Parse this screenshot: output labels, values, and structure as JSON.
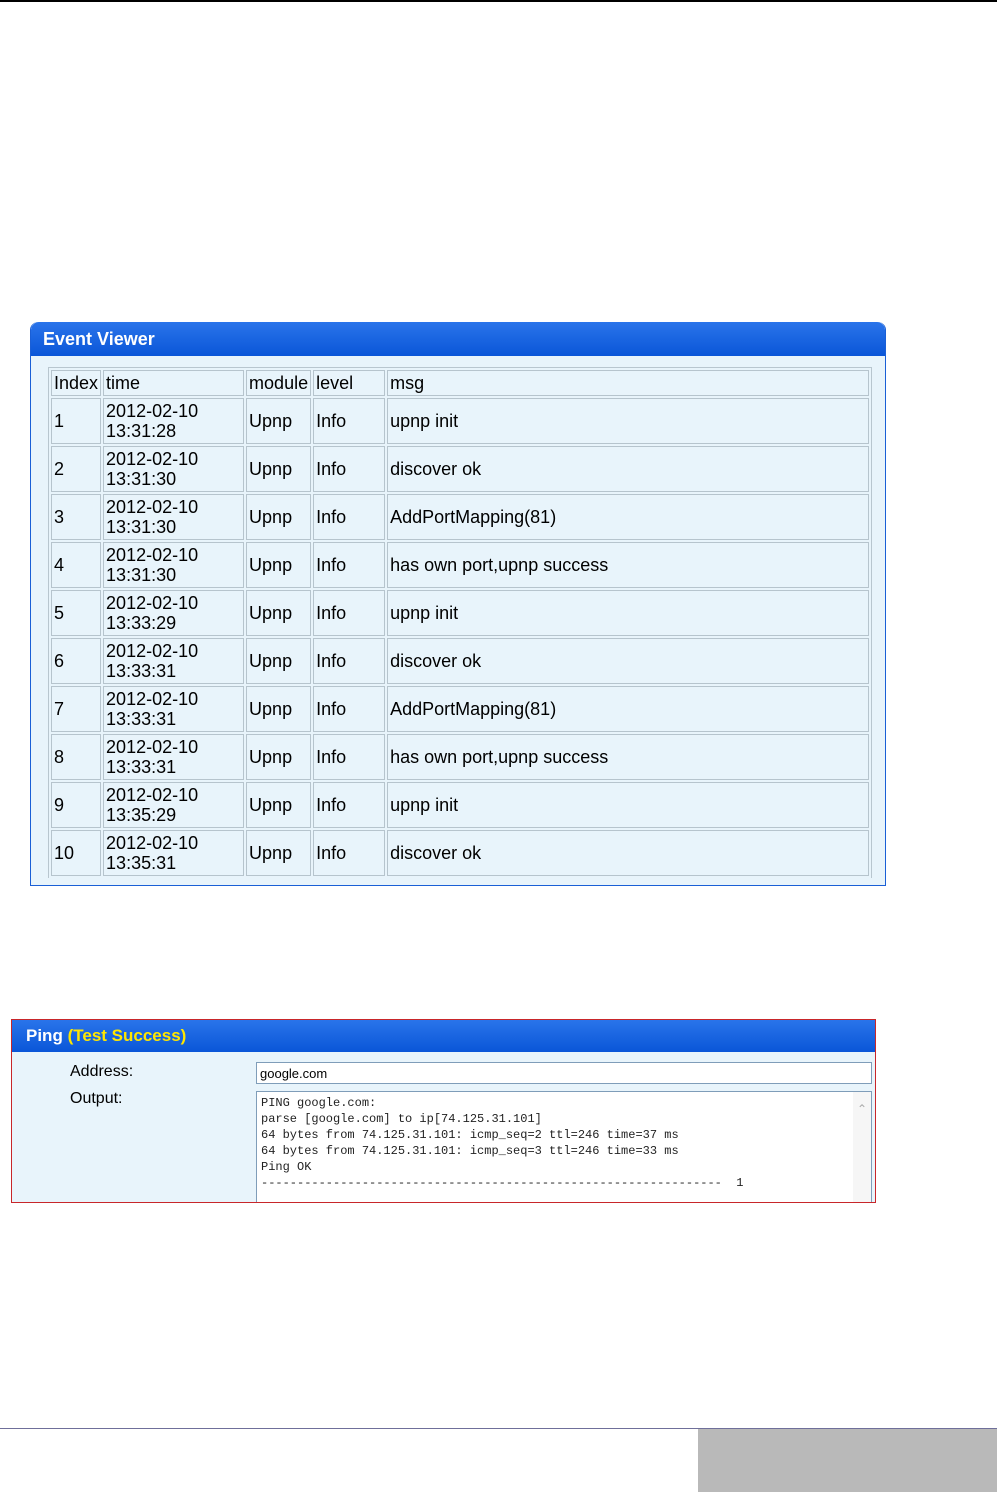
{
  "event_viewer": {
    "title": "Event Viewer",
    "columns": [
      "Index",
      "time",
      "module",
      "level",
      "msg"
    ],
    "rows": [
      {
        "index": "1",
        "date": "2012-02-10",
        "time": "13:31:28",
        "module": "Upnp",
        "level": "Info",
        "msg": "upnp init"
      },
      {
        "index": "2",
        "date": "2012-02-10",
        "time": "13:31:30",
        "module": "Upnp",
        "level": "Info",
        "msg": "discover ok"
      },
      {
        "index": "3",
        "date": "2012-02-10",
        "time": "13:31:30",
        "module": "Upnp",
        "level": "Info",
        "msg": "AddPortMapping(81)"
      },
      {
        "index": "4",
        "date": "2012-02-10",
        "time": "13:31:30",
        "module": "Upnp",
        "level": "Info",
        "msg": "has own port,upnp success"
      },
      {
        "index": "5",
        "date": "2012-02-10",
        "time": "13:33:29",
        "module": "Upnp",
        "level": "Info",
        "msg": "upnp init"
      },
      {
        "index": "6",
        "date": "2012-02-10",
        "time": "13:33:31",
        "module": "Upnp",
        "level": "Info",
        "msg": "discover ok"
      },
      {
        "index": "7",
        "date": "2012-02-10",
        "time": "13:33:31",
        "module": "Upnp",
        "level": "Info",
        "msg": "AddPortMapping(81)"
      },
      {
        "index": "8",
        "date": "2012-02-10",
        "time": "13:33:31",
        "module": "Upnp",
        "level": "Info",
        "msg": "has own port,upnp success"
      },
      {
        "index": "9",
        "date": "2012-02-10",
        "time": "13:35:29",
        "module": "Upnp",
        "level": "Info",
        "msg": "upnp init"
      },
      {
        "index": "10",
        "date": "2012-02-10",
        "time": "13:35:31",
        "module": "Upnp",
        "level": "Info",
        "msg": "discover ok"
      }
    ]
  },
  "ping": {
    "title": "Ping",
    "status": "(Test Success)",
    "address_label": "Address:",
    "address_value": "google.com",
    "output_label": "Output:",
    "output_text": "PING google.com:\nparse [google.com] to ip[74.125.31.101]\n64 bytes from 74.125.31.101: icmp_seq=2 ttl=246 time=37 ms\n64 bytes from 74.125.31.101: icmp_seq=3 ttl=246 time=33 ms\nPing OK\n----------------------------------------------------------------  1"
  },
  "colors": {
    "header_blue": "#0a56d8",
    "panel_bg": "#e8f4fb",
    "status_yellow": "#ffe600",
    "ping_border_red": "#c8262a",
    "footer_gray": "#b9b9b9"
  }
}
